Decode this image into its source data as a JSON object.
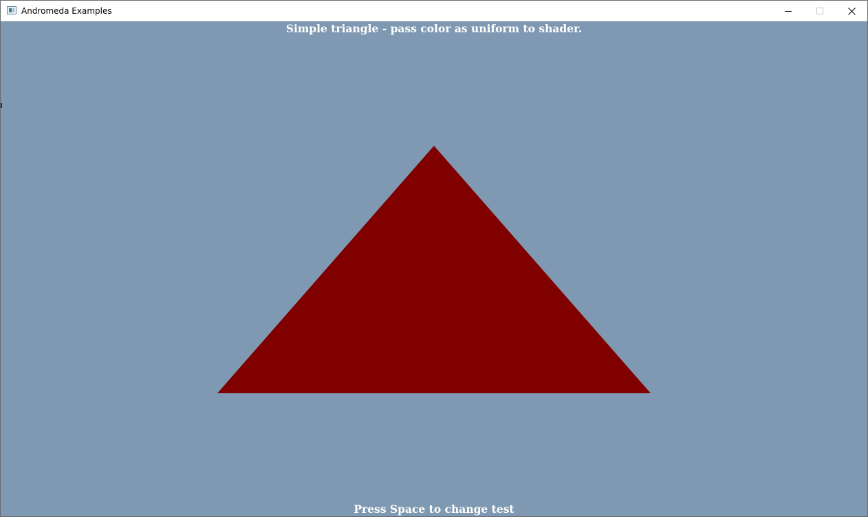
{
  "window": {
    "title": "Andromeda Examples",
    "icon": "app-icon",
    "controls": {
      "minimize": "minimize-icon",
      "maximize": "maximize-icon",
      "close": "close-icon"
    }
  },
  "scene": {
    "title": "Simple triangle - pass color as uniform to shader.",
    "footer": "Press Space to change test",
    "background_color": "#7f99b2",
    "triangle_color": "#800000"
  }
}
